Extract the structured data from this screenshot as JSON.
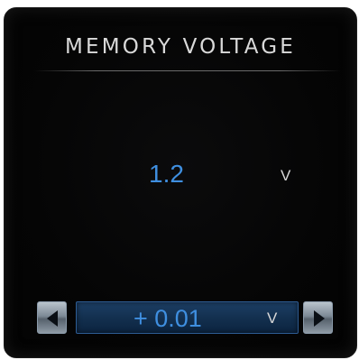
{
  "widget": {
    "title": "MEMORY VOLTAGE",
    "current_value": "1.2",
    "current_unit": "V"
  },
  "stepper": {
    "step_value": "+ 0.01",
    "step_unit": "V",
    "decrement_icon": "arrow-left-icon",
    "increment_icon": "arrow-right-icon"
  },
  "colors": {
    "value_blue": "#3f8fe0",
    "panel_bg": "#050505",
    "title_text": "#d9d9d9",
    "stepper_bg": "#1d3f66"
  }
}
